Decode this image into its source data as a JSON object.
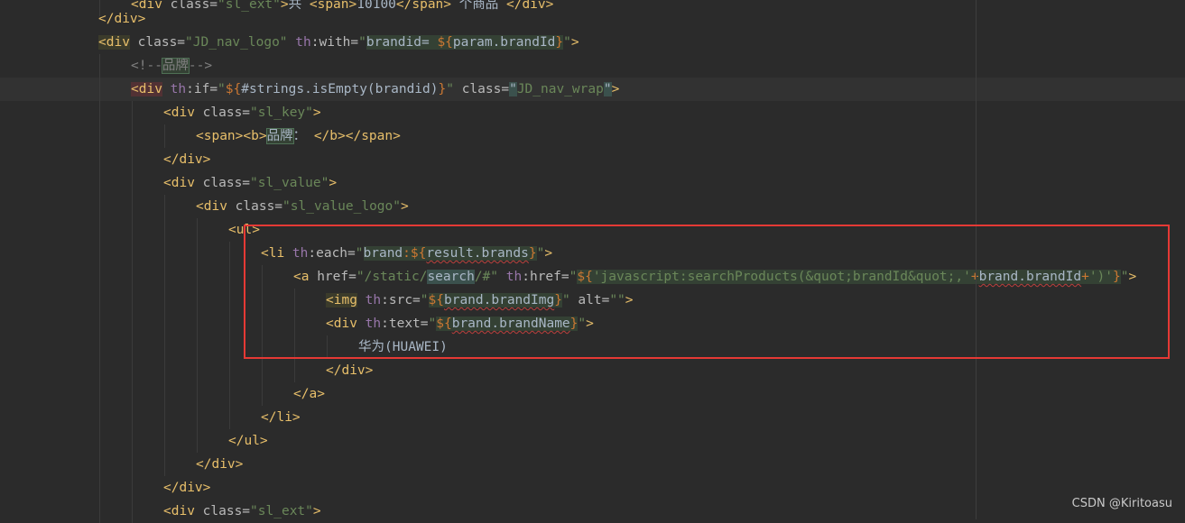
{
  "editor": {
    "lines": [
      [
        {
          "t": "<div ",
          "c": "tag"
        },
        {
          "t": "class=",
          "c": "attr"
        },
        {
          "t": "\"sl_ext\"",
          "c": "str"
        },
        {
          "t": ">",
          "c": "tag"
        },
        {
          "t": "共 ",
          "c": "pl"
        },
        {
          "t": "<span>",
          "c": "tag"
        },
        {
          "t": "10100",
          "c": "pl"
        },
        {
          "t": "</span>",
          "c": "tag"
        },
        {
          "t": " 个商品 ",
          "c": "pl"
        },
        {
          "t": "</div>",
          "c": "tag"
        }
      ],
      [
        {
          "t": "</div>",
          "c": "tag"
        }
      ],
      [
        {
          "t": "<div",
          "c": "tag hl-tag"
        },
        {
          "t": " ",
          "c": "pl"
        },
        {
          "t": "class=",
          "c": "attr"
        },
        {
          "t": "\"JD_nav_logo\"",
          "c": "str"
        },
        {
          "t": " ",
          "c": "pl"
        },
        {
          "t": "th",
          "c": "ns"
        },
        {
          "t": ":with=",
          "c": "attr"
        },
        {
          "t": "\"",
          "c": "str"
        },
        {
          "t": "brandid= ",
          "c": "expr hl-expr"
        },
        {
          "t": "${",
          "c": "brace hl-expr"
        },
        {
          "t": "param.brandId",
          "c": "expr hl-expr"
        },
        {
          "t": "}",
          "c": "brace hl-expr"
        },
        {
          "t": "\"",
          "c": "str"
        },
        {
          "t": ">",
          "c": "tag"
        }
      ],
      [
        {
          "t": "<!--",
          "c": "comment"
        },
        {
          "t": "品牌",
          "c": "comment hl-box"
        },
        {
          "t": "-->",
          "c": "comment"
        }
      ],
      [
        {
          "t": "<div",
          "c": "tag hl-red"
        },
        {
          "t": " ",
          "c": "pl"
        },
        {
          "t": "th",
          "c": "ns"
        },
        {
          "t": ":if=",
          "c": "attr"
        },
        {
          "t": "\"",
          "c": "str"
        },
        {
          "t": "${",
          "c": "brace"
        },
        {
          "t": "#strings.isEmpty(brandid)",
          "c": "expr"
        },
        {
          "t": "}",
          "c": "brace"
        },
        {
          "t": "\"",
          "c": "str"
        },
        {
          "t": " class=",
          "c": "attr"
        },
        {
          "t": "\"",
          "c": "str hl-match"
        },
        {
          "t": "JD_nav_wrap",
          "c": "str"
        },
        {
          "t": "\"",
          "c": "str hl-match"
        },
        {
          "t": ">",
          "c": "tag"
        }
      ],
      [
        {
          "t": "<div ",
          "c": "tag"
        },
        {
          "t": "class=",
          "c": "attr"
        },
        {
          "t": "\"sl_key\"",
          "c": "str"
        },
        {
          "t": ">",
          "c": "tag"
        }
      ],
      [
        {
          "t": "<span><b>",
          "c": "tag"
        },
        {
          "t": "品牌",
          "c": "pl hl-box"
        },
        {
          "t": "： ",
          "c": "pl"
        },
        {
          "t": "</b></span>",
          "c": "tag"
        }
      ],
      [
        {
          "t": "</div>",
          "c": "tag"
        }
      ],
      [
        {
          "t": "<div ",
          "c": "tag"
        },
        {
          "t": "class=",
          "c": "attr"
        },
        {
          "t": "\"sl_value\"",
          "c": "str"
        },
        {
          "t": ">",
          "c": "tag"
        }
      ],
      [
        {
          "t": "<div ",
          "c": "tag"
        },
        {
          "t": "class=",
          "c": "attr"
        },
        {
          "t": "\"sl_value_logo\"",
          "c": "str"
        },
        {
          "t": ">",
          "c": "tag"
        }
      ],
      [
        {
          "t": "<ul>",
          "c": "tag"
        }
      ],
      [
        {
          "t": "<li ",
          "c": "tag"
        },
        {
          "t": "th",
          "c": "ns"
        },
        {
          "t": ":each=",
          "c": "attr"
        },
        {
          "t": "\"",
          "c": "str"
        },
        {
          "t": "brand",
          "c": "expr hl-expr"
        },
        {
          "t": ":",
          "c": "brace hl-expr"
        },
        {
          "t": "${",
          "c": "brace hl-expr"
        },
        {
          "t": "result.brands",
          "c": "expr hl-expr squig"
        },
        {
          "t": "}",
          "c": "brace hl-expr"
        },
        {
          "t": "\"",
          "c": "str"
        },
        {
          "t": ">",
          "c": "tag"
        }
      ],
      [
        {
          "t": "<a ",
          "c": "tag"
        },
        {
          "t": "href=",
          "c": "attr"
        },
        {
          "t": "\"/static/",
          "c": "str"
        },
        {
          "t": "search",
          "c": "str hl-match"
        },
        {
          "t": "/#\"",
          "c": "str"
        },
        {
          "t": " ",
          "c": "pl"
        },
        {
          "t": "th",
          "c": "ns"
        },
        {
          "t": ":href=",
          "c": "attr"
        },
        {
          "t": "\"",
          "c": "str"
        },
        {
          "t": "${",
          "c": "brace hl-expr"
        },
        {
          "t": "'javascript:searchProducts(&quot;brandId&quot;,'",
          "c": "jsstr hl-expr"
        },
        {
          "t": "+",
          "c": "brace hl-expr"
        },
        {
          "t": "brand.brandId",
          "c": "expr hl-expr squig"
        },
        {
          "t": "+",
          "c": "brace hl-expr"
        },
        {
          "t": "')'",
          "c": "jsstr hl-expr"
        },
        {
          "t": "}",
          "c": "brace hl-expr"
        },
        {
          "t": "\"",
          "c": "str"
        },
        {
          "t": ">",
          "c": "tag"
        }
      ],
      [
        {
          "t": "<img",
          "c": "tag hl-tag"
        },
        {
          "t": " ",
          "c": "pl"
        },
        {
          "t": "th",
          "c": "ns"
        },
        {
          "t": ":src=",
          "c": "attr"
        },
        {
          "t": "\"",
          "c": "str"
        },
        {
          "t": "${",
          "c": "brace hl-expr"
        },
        {
          "t": "brand.brandImg",
          "c": "expr hl-expr squig"
        },
        {
          "t": "}",
          "c": "brace hl-expr"
        },
        {
          "t": "\"",
          "c": "str"
        },
        {
          "t": " alt=",
          "c": "attr"
        },
        {
          "t": "\"\"",
          "c": "str"
        },
        {
          "t": ">",
          "c": "tag"
        }
      ],
      [
        {
          "t": "<div ",
          "c": "tag"
        },
        {
          "t": "th",
          "c": "ns"
        },
        {
          "t": ":text=",
          "c": "attr"
        },
        {
          "t": "\"",
          "c": "str"
        },
        {
          "t": "${",
          "c": "brace hl-expr"
        },
        {
          "t": "brand.brandName",
          "c": "expr hl-expr squig"
        },
        {
          "t": "}",
          "c": "brace hl-expr"
        },
        {
          "t": "\"",
          "c": "str"
        },
        {
          "t": ">",
          "c": "tag"
        }
      ],
      [
        {
          "t": "华为(HUAWEI)",
          "c": "pl"
        }
      ],
      [
        {
          "t": "</div>",
          "c": "tag"
        }
      ],
      [
        {
          "t": "</a>",
          "c": "tag"
        }
      ],
      [
        {
          "t": "</li>",
          "c": "tag"
        }
      ],
      [
        {
          "t": "</ul>",
          "c": "tag"
        }
      ],
      [
        {
          "t": "</div>",
          "c": "tag"
        }
      ],
      [
        {
          "t": "</div>",
          "c": "tag"
        }
      ],
      [
        {
          "t": "<div ",
          "c": "tag"
        },
        {
          "t": "class=",
          "c": "attr"
        },
        {
          "t": "\"sl_ext\"",
          "c": "str"
        },
        {
          "t": ">",
          "c": "tag"
        }
      ]
    ],
    "current_line": 4,
    "colors": {
      "background": "#2b2b2b",
      "tag": "#e8bf6a",
      "string": "#6a8759",
      "namespace": "#9876aa",
      "selection_box": "#e53935"
    }
  },
  "watermark": "CSDN @Kiritoasu"
}
